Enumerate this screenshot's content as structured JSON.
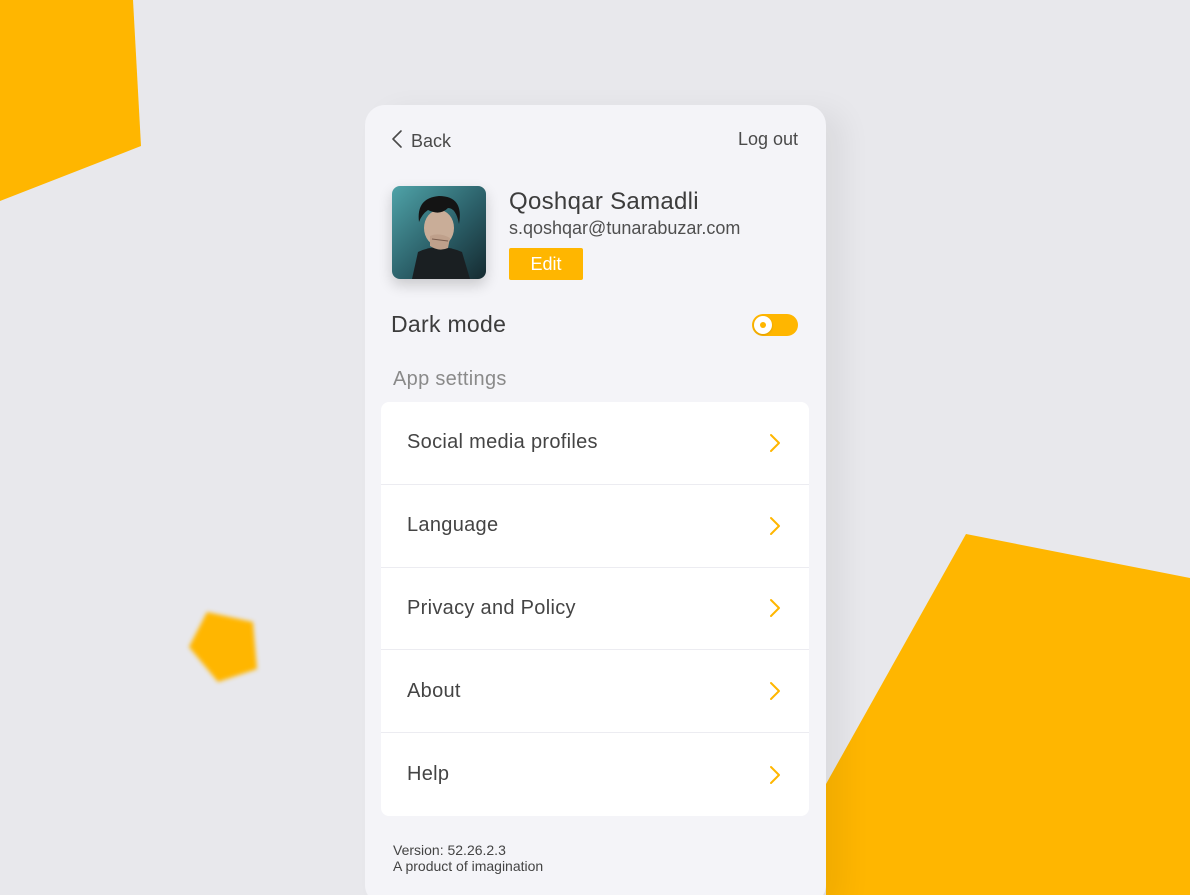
{
  "colors": {
    "accent": "#ffb600",
    "background": "#e8e8ec",
    "card": "#f4f4f8"
  },
  "nav": {
    "back_label": "Back",
    "back_icon": "chevron-left-icon",
    "logout_label": "Log out"
  },
  "profile": {
    "name": "Qoshqar Samadli",
    "email": "s.qoshqar@tunarabuzar.com",
    "edit_label": "Edit"
  },
  "dark_mode": {
    "label": "Dark mode",
    "enabled": false
  },
  "settings": {
    "section_label": "App settings",
    "items": [
      {
        "label": "Social media profiles",
        "icon": "chevron-right-icon"
      },
      {
        "label": "Language",
        "icon": "chevron-right-icon"
      },
      {
        "label": "Privacy and Policy",
        "icon": "chevron-right-icon"
      },
      {
        "label": "About",
        "icon": "chevron-right-icon"
      },
      {
        "label": "Help",
        "icon": "chevron-right-icon"
      }
    ]
  },
  "footer": {
    "version": "Version: 52.26.2.3",
    "tagline": "A product of imagination"
  }
}
